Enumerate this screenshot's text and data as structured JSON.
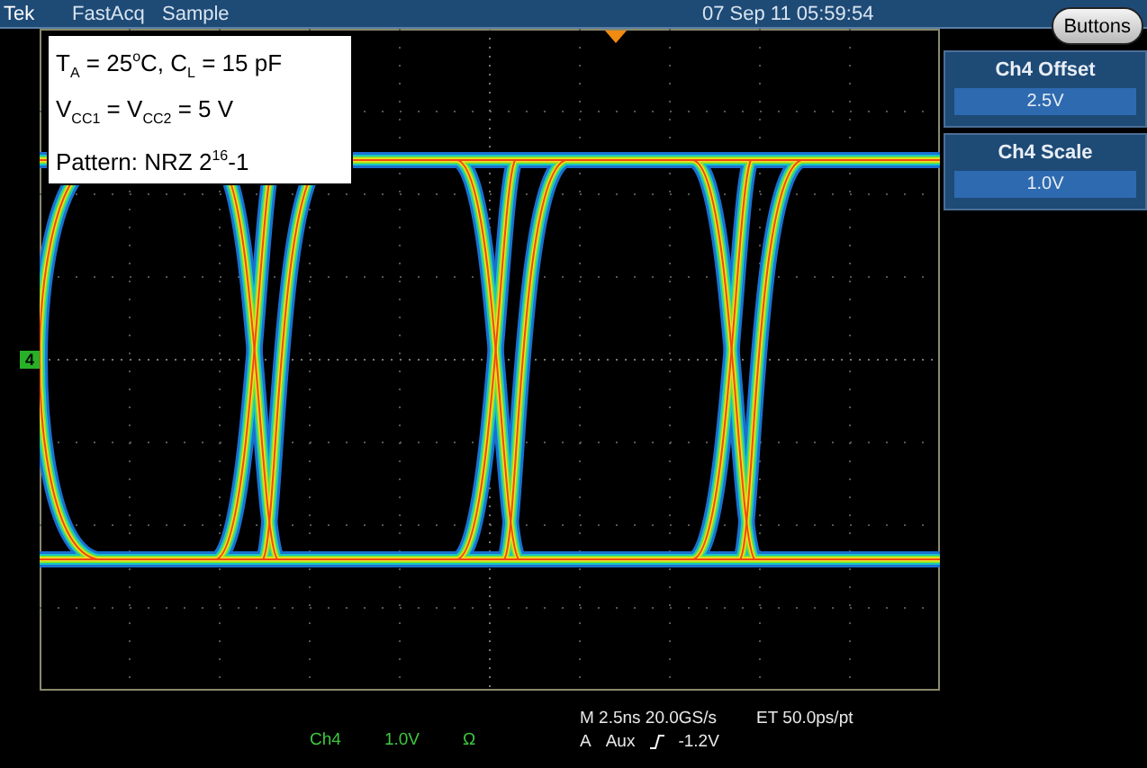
{
  "header": {
    "brand": "Tek",
    "acquisition_mode": "FastAcq",
    "sample_mode": "Sample",
    "datetime": "07 Sep 11 05:59:54"
  },
  "buttons_button": "Buttons",
  "annotation": [
    "T$_{A}$ = 25$^{o}$C, C$_{L}$ = 15 pF",
    "V$_{CC1}$ = V$_{CC2}$ = 5 V",
    "Pattern: NRZ 2$^{16}$-1"
  ],
  "channel_marker": "4",
  "side_menu": [
    {
      "title": "Ch4 Offset",
      "value": "2.5V"
    },
    {
      "title": "Ch4 Scale",
      "value": "1.0V"
    }
  ],
  "status": {
    "channel": "Ch4",
    "scale": "1.0V",
    "coupling": "Ω",
    "timebase": "M 2.5ns 20.0GS/s",
    "record": "ET 50.0ps/pt",
    "trigger_prefix": "A",
    "trigger_source": "Aux",
    "trigger_level": "-1.2V"
  }
}
